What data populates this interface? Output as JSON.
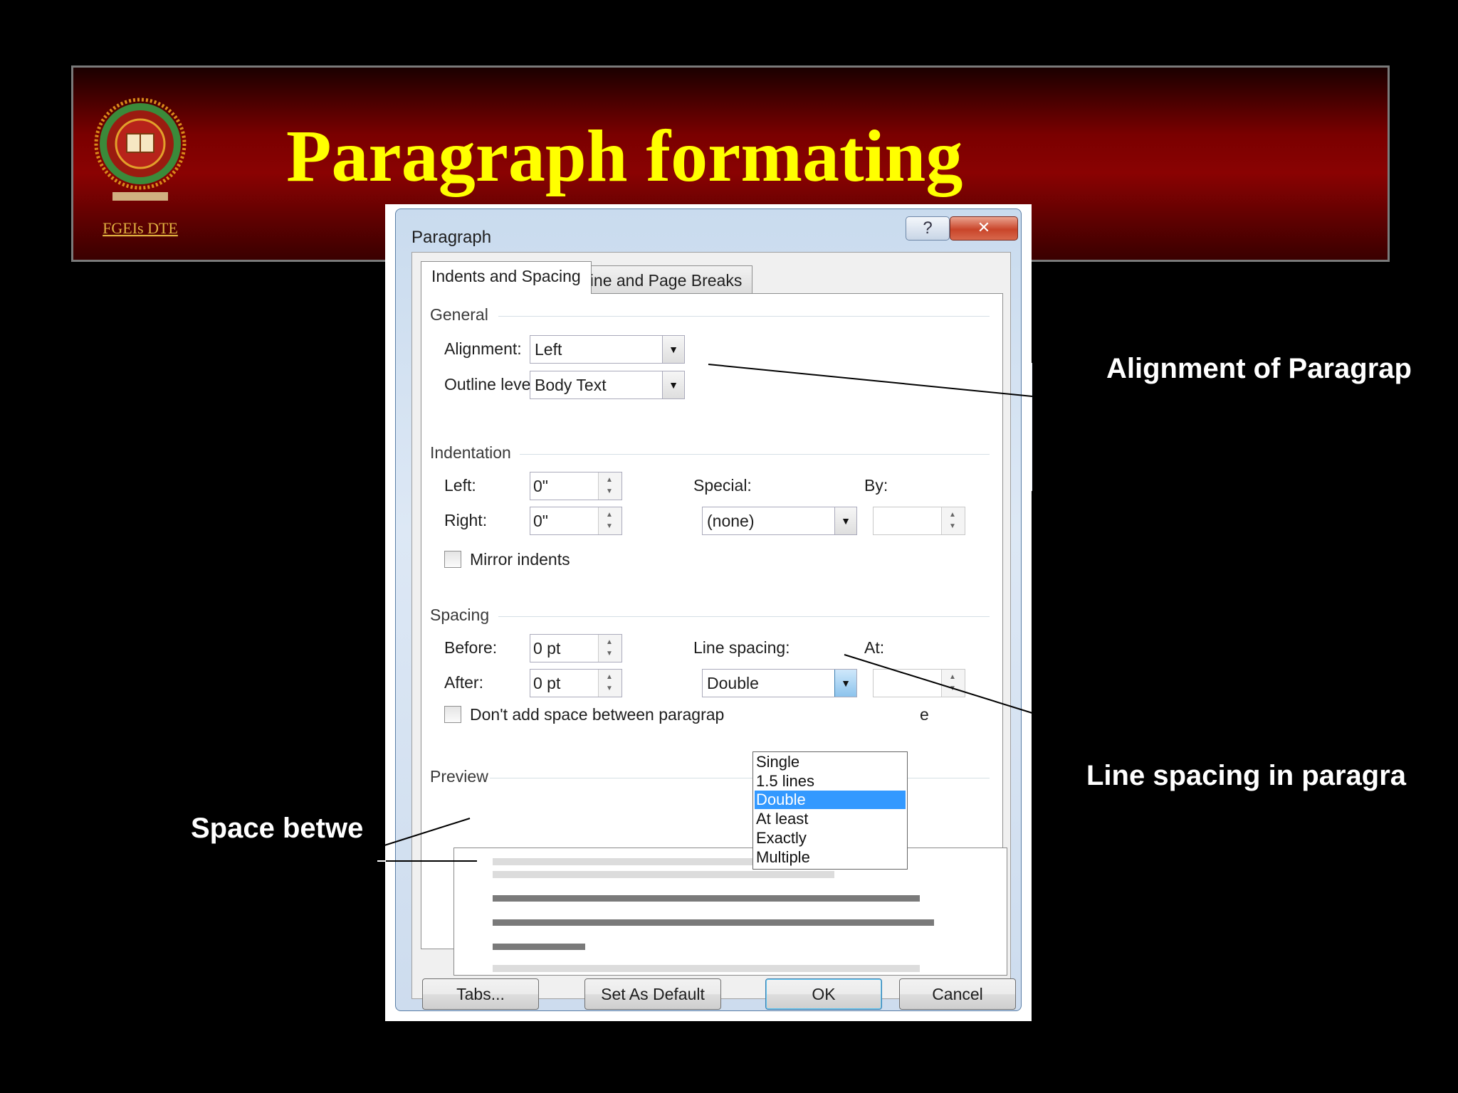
{
  "slide": {
    "title": "Paragraph formating",
    "logo_text": "FGEIs DTE"
  },
  "callouts": {
    "alignment": "Alignment of Paragrap",
    "line_spacing": "Line spacing in paragra",
    "space_between": "Space betwe"
  },
  "dialog": {
    "title": "Paragraph",
    "help_glyph": "?",
    "close_glyph": "✕",
    "tabs": [
      {
        "label": "Indents and Spacing",
        "active": true
      },
      {
        "label": "Line and Page Breaks",
        "active": false
      }
    ],
    "general": {
      "heading": "General",
      "alignment_label": "Alignment:",
      "alignment_value": "Left",
      "outline_label": "Outline level:",
      "outline_value": "Body Text"
    },
    "indentation": {
      "heading": "Indentation",
      "left_label": "Left:",
      "left_value": "0\"",
      "right_label": "Right:",
      "right_value": "0\"",
      "special_label": "Special:",
      "special_value": "(none)",
      "by_label": "By:",
      "by_value": "",
      "mirror_label": "Mirror indents",
      "mirror_checked": false
    },
    "spacing": {
      "heading": "Spacing",
      "before_label": "Before:",
      "before_value": "0 pt",
      "after_label": "After:",
      "after_value": "0 pt",
      "line_spacing_label": "Line spacing:",
      "line_spacing_value": "Double",
      "at_label": "At:",
      "at_value": "",
      "dont_add_label": "Don't add space between paragrap",
      "dont_add_checked": false,
      "dont_add_trailing": "e",
      "line_spacing_options": [
        "Single",
        "1.5 lines",
        "Double",
        "At least",
        "Exactly",
        "Multiple"
      ],
      "selected_option": "Double"
    },
    "preview": {
      "heading": "Preview"
    },
    "buttons": {
      "tabs": "Tabs...",
      "set_default": "Set As Default",
      "ok": "OK",
      "cancel": "Cancel"
    }
  },
  "colors": {
    "title_yellow": "#ffff00",
    "banner_red": "#8a0202",
    "selection_blue": "#3399ff"
  }
}
